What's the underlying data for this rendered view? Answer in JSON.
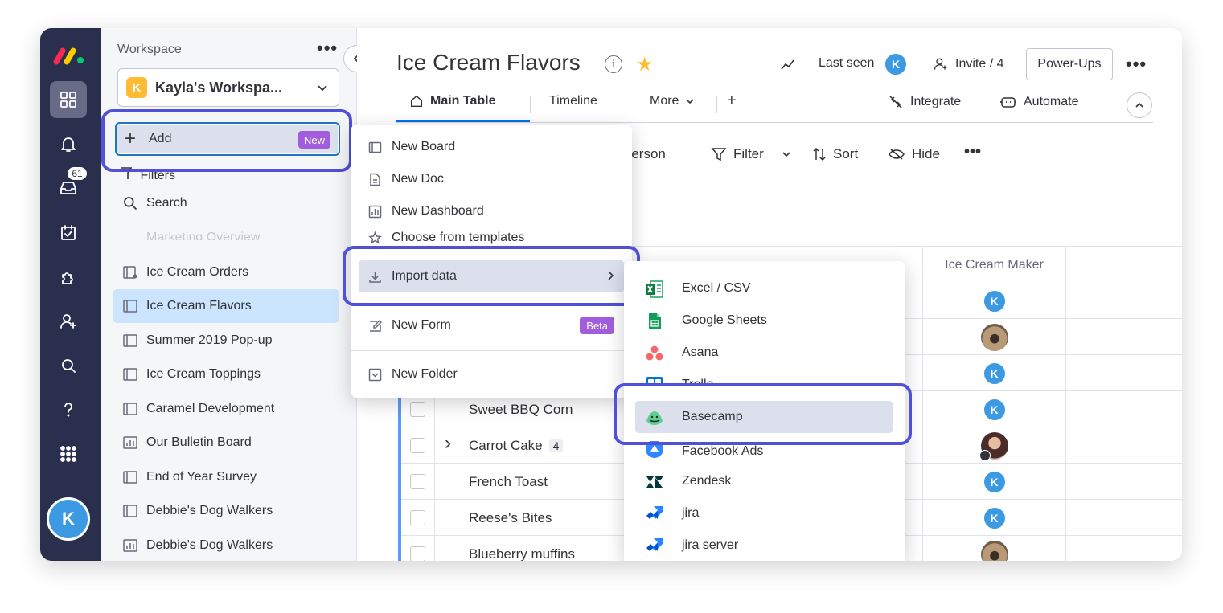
{
  "colors": {
    "rail_bg": "#292f4c",
    "accent_blue": "#0073ea",
    "highlight_outline": "#5050d8",
    "badge_purple": "#a25ddc",
    "workspace_badge": "#fdbc34",
    "avatar_blue": "#3c9ae3"
  },
  "rail": {
    "items": [
      "workspaces-icon",
      "bell-icon",
      "inbox-icon",
      "my-work-icon",
      "apps-icon",
      "invite-icon",
      "search-icon",
      "help-icon",
      "menu-grid-icon"
    ],
    "inbox_count": "61",
    "avatar_initial": "K"
  },
  "sidebar": {
    "workspace_label": "Workspace",
    "more": "•••",
    "workspace_initial": "K",
    "workspace_name": "Kayla's Workspa...",
    "add_label": "Add",
    "new_badge": "New",
    "filters_label": "Filters",
    "search_label": "Search",
    "ghost_item": "Marketing Overview",
    "boards": [
      {
        "label": "Ice Cream Orders",
        "icon": "board-share-icon"
      },
      {
        "label": "Ice Cream Flavors",
        "icon": "board-icon"
      },
      {
        "label": "Summer 2019 Pop-up",
        "icon": "board-icon"
      },
      {
        "label": "Ice Cream Toppings",
        "icon": "board-icon"
      },
      {
        "label": "Caramel Development",
        "icon": "board-icon"
      },
      {
        "label": "Our Bulletin Board",
        "icon": "dashboard-icon"
      },
      {
        "label": "End of Year Survey",
        "icon": "board-icon"
      },
      {
        "label": "Debbie's Dog Walkers",
        "icon": "board-icon"
      },
      {
        "label": "Debbie's Dog Walkers",
        "icon": "dashboard-icon"
      }
    ]
  },
  "header": {
    "title": "Ice Cream Flavors",
    "info": "i",
    "star": "★",
    "last_seen_label": "Last seen",
    "last_seen_avatar": "K",
    "invite_label": "Invite / 4",
    "powerups_label": "Power-Ups",
    "more": "•••"
  },
  "tabs": {
    "main_table": "Main Table",
    "timeline": "Timeline",
    "more": "More",
    "add": "+",
    "integrate": "Integrate",
    "automate": "Automate"
  },
  "toolbar": {
    "person": "Person",
    "filter": "Filter",
    "sort": "Sort",
    "hide": "Hide",
    "more": "•••"
  },
  "table": {
    "maker_header": "Ice Cream Maker",
    "rows": [
      {
        "name": "",
        "maker": "K",
        "maker_type": "initial"
      },
      {
        "name": "",
        "maker": "",
        "maker_type": "pug"
      },
      {
        "name": "",
        "maker": "K",
        "maker_type": "initial"
      },
      {
        "name": "Sweet BBQ Corn",
        "maker": "K",
        "maker_type": "initial"
      },
      {
        "name": "Carrot Cake",
        "count": "4",
        "maker": "",
        "maker_type": "person"
      },
      {
        "name": "French Toast",
        "maker": "K",
        "maker_type": "initial"
      },
      {
        "name": "Reese's Bites",
        "maker": "K",
        "maker_type": "initial"
      },
      {
        "name": "Blueberry muffins",
        "maker": "",
        "maker_type": "pug"
      }
    ]
  },
  "add_menu": {
    "items": [
      {
        "label": "New Board",
        "icon": "board-icon"
      },
      {
        "label": "New Doc",
        "icon": "doc-icon"
      },
      {
        "label": "New Dashboard",
        "icon": "dashboard-icon"
      },
      {
        "label": "Choose from templates",
        "icon": "templates-icon"
      },
      {
        "label": "Import data",
        "icon": "import-icon"
      },
      {
        "label": "New Form",
        "icon": "form-icon"
      },
      {
        "label": "New Folder",
        "icon": "folder-icon"
      }
    ],
    "beta_badge": "Beta"
  },
  "import_menu": {
    "items": [
      {
        "label": "Excel / CSV",
        "icon": "excel-icon"
      },
      {
        "label": "Google Sheets",
        "icon": "google-sheets-icon"
      },
      {
        "label": "Asana",
        "icon": "asana-icon"
      },
      {
        "label": "Trello",
        "icon": "trello-icon"
      },
      {
        "label": "Basecamp",
        "icon": "basecamp-icon"
      },
      {
        "label": "Facebook Ads",
        "icon": "facebook-ads-icon"
      },
      {
        "label": "Zendesk",
        "icon": "zendesk-icon"
      },
      {
        "label": "jira",
        "icon": "jira-icon"
      },
      {
        "label": "jira server",
        "icon": "jira-server-icon"
      }
    ]
  }
}
